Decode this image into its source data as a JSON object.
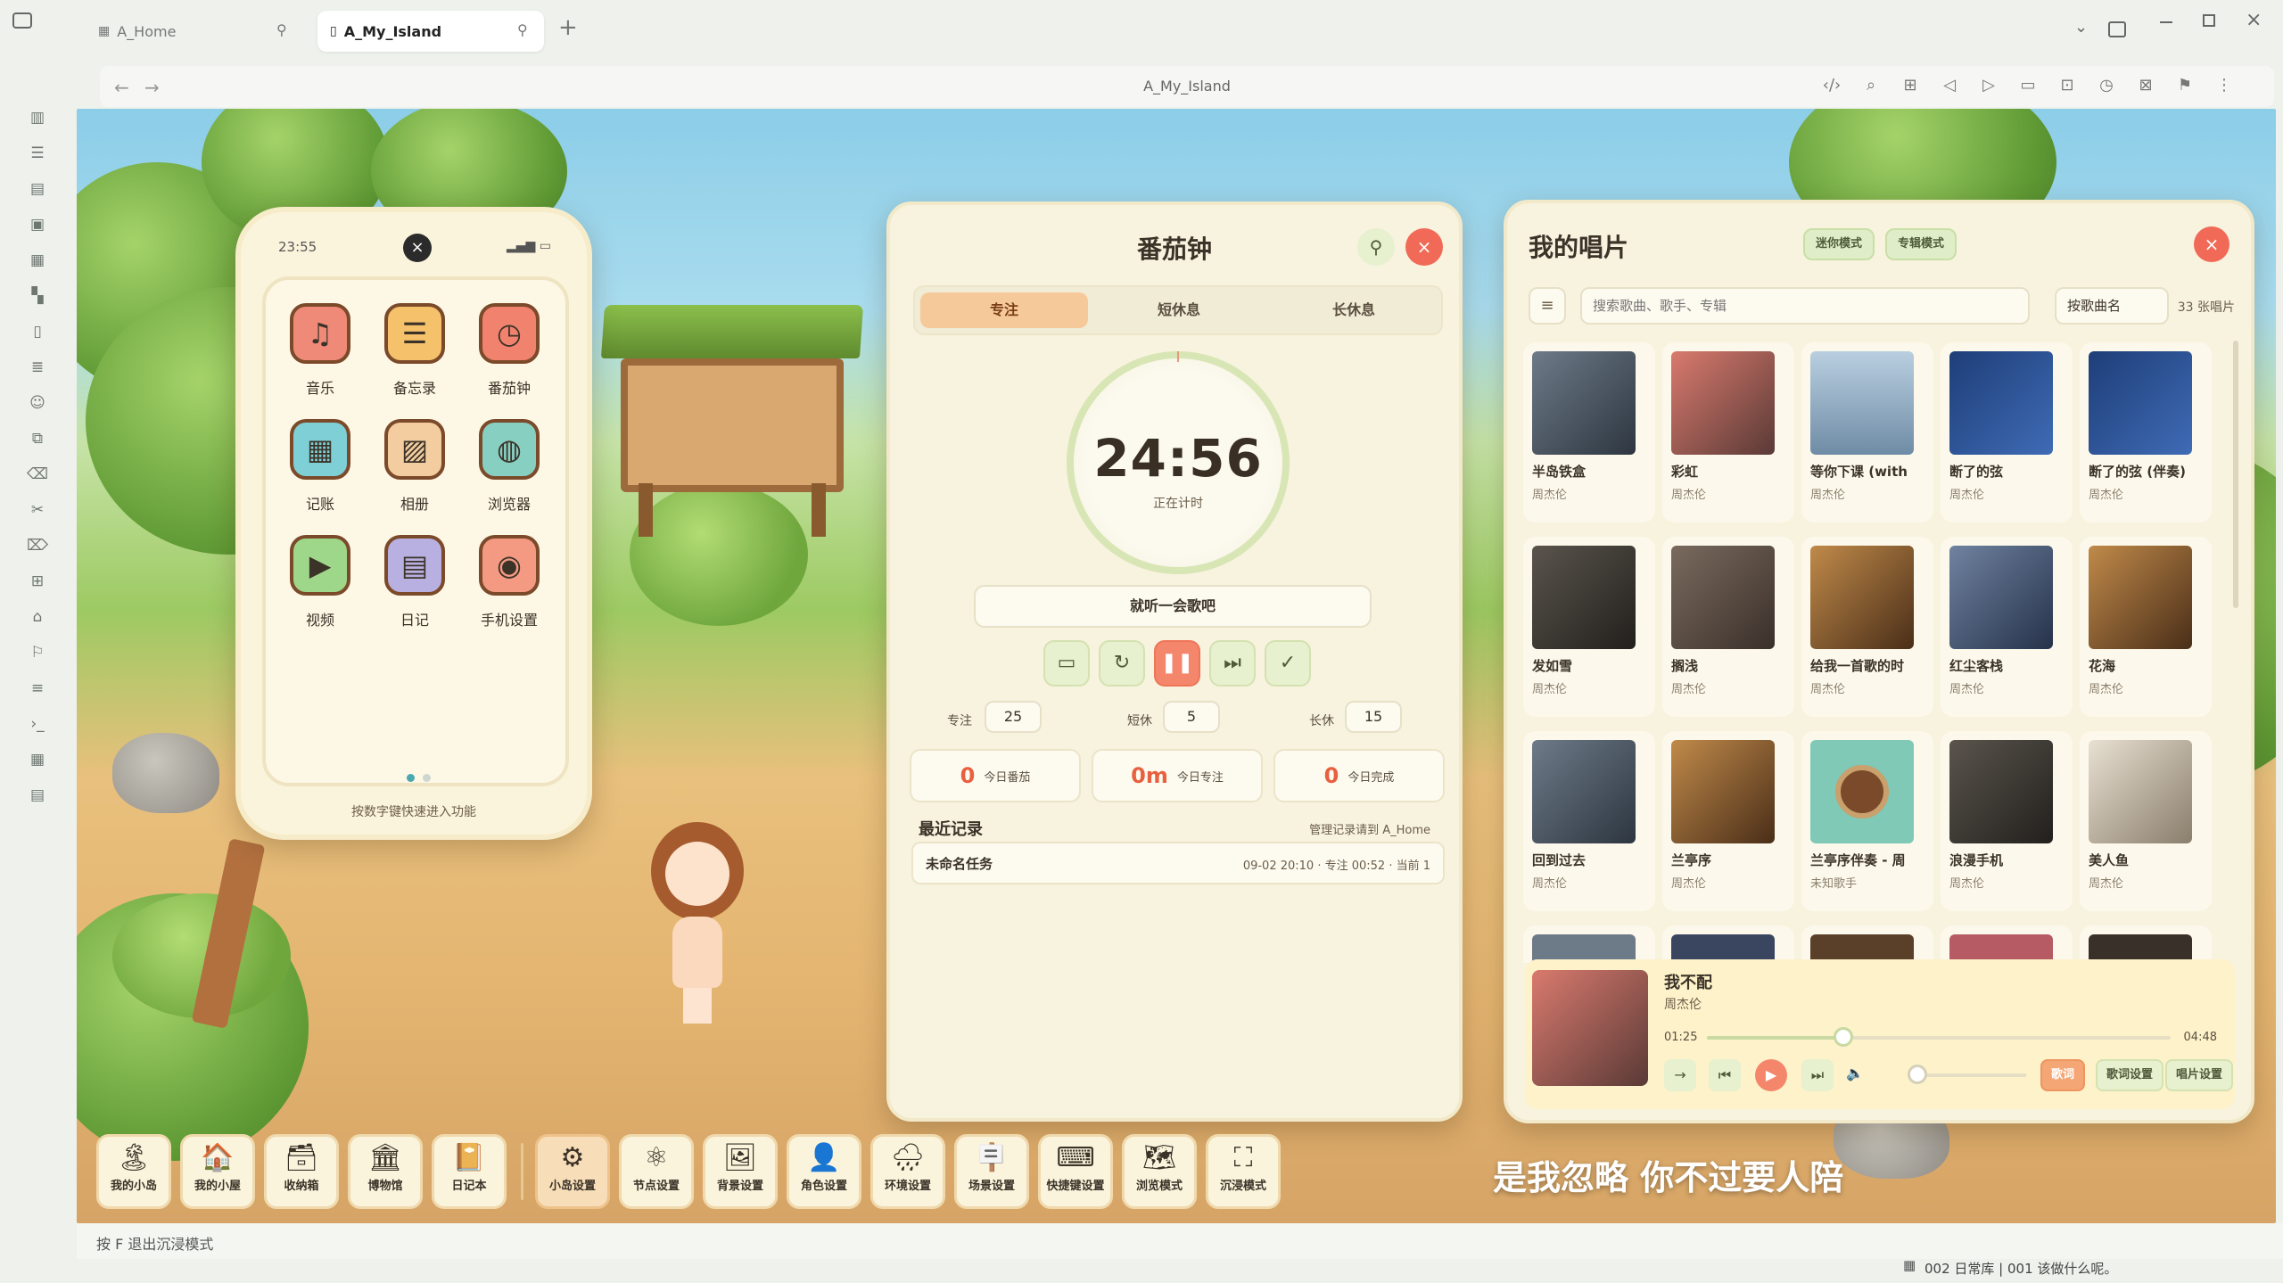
{
  "browser": {
    "tabs": [
      {
        "label": "A_Home",
        "active": false
      },
      {
        "label": "A_My_Island",
        "active": true
      }
    ],
    "new_tab": "+",
    "address": "A_My_Island"
  },
  "phone": {
    "time": "23:55",
    "apps": [
      {
        "label": "音乐",
        "icon": "music-icon",
        "color": "#f08a78"
      },
      {
        "label": "备忘录",
        "icon": "notes-icon",
        "color": "#f5c26b"
      },
      {
        "label": "番茄钟",
        "icon": "tomato-clock-icon",
        "color": "#f0826e"
      },
      {
        "label": "记账",
        "icon": "calculator-icon",
        "color": "#7ed0d6"
      },
      {
        "label": "相册",
        "icon": "photo-icon",
        "color": "#f3cda0"
      },
      {
        "label": "浏览器",
        "icon": "globe-icon",
        "color": "#86cfc1"
      },
      {
        "label": "视频",
        "icon": "video-icon",
        "color": "#9fd78a"
      },
      {
        "label": "日记",
        "icon": "diary-icon",
        "color": "#b9b0e2"
      },
      {
        "label": "手机设置",
        "icon": "phone-settings-icon",
        "color": "#f59a82"
      }
    ],
    "hint": "按数字键快速进入功能"
  },
  "pomodoro": {
    "title": "番茄钟",
    "tabs": [
      "专注",
      "短休息",
      "长休息"
    ],
    "active_tab": 0,
    "timer": "24:56",
    "timer_status": "正在计时",
    "task": "就听一会歌吧",
    "durations": [
      {
        "label": "专注",
        "value": "25"
      },
      {
        "label": "短休",
        "value": "5"
      },
      {
        "label": "长休",
        "value": "15"
      }
    ],
    "stats": [
      {
        "num": "0",
        "label": "今日番茄"
      },
      {
        "num": "0m",
        "label": "今日专注"
      },
      {
        "num": "0",
        "label": "今日完成"
      }
    ],
    "recent_title": "最近记录",
    "recent_manage": "管理记录请到 A_Home",
    "recent": [
      {
        "name": "未命名任务",
        "meta": "09-02 20:10 · 专注 00:52 · 当前 1"
      }
    ]
  },
  "music": {
    "title": "我的唱片",
    "modes": [
      "迷你模式",
      "专辑模式"
    ],
    "search_placeholder": "搜索歌曲、歌手、专辑",
    "sort": "按歌曲名",
    "count": "33 张唱片",
    "songs": [
      {
        "title": "半岛铁盒",
        "artist": "周杰伦",
        "cover": "#5d6a78"
      },
      {
        "title": "彩虹",
        "artist": "周杰伦",
        "cover": "#b65a63"
      },
      {
        "title": "等你下课 (with",
        "artist": "周杰伦",
        "cover": "#7ea3c4"
      },
      {
        "title": "断了的弦",
        "artist": "周杰伦",
        "cover": "#2d4f8a"
      },
      {
        "title": "断了的弦 (伴奏)",
        "artist": "周杰伦",
        "cover": "#2d4f8a"
      },
      {
        "title": "发如雪",
        "artist": "周杰伦",
        "cover": "#3e3a36"
      },
      {
        "title": "搁浅",
        "artist": "周杰伦",
        "cover": "#5d5048"
      },
      {
        "title": "给我一首歌的时",
        "artist": "周杰伦",
        "cover": "#8a5a2f"
      },
      {
        "title": "红尘客栈",
        "artist": "周杰伦",
        "cover": "#4c5e78"
      },
      {
        "title": "花海",
        "artist": "周杰伦",
        "cover": "#8a5a2f"
      },
      {
        "title": "回到过去",
        "artist": "周杰伦",
        "cover": "#5d6a78"
      },
      {
        "title": "兰亭序",
        "artist": "周杰伦",
        "cover": "#8a5a2f"
      },
      {
        "title": "兰亭序伴奏 - 周",
        "artist": "未知歌手",
        "cover": "#7fc9b6"
      },
      {
        "title": "浪漫手机",
        "artist": "周杰伦",
        "cover": "#3e3a36"
      },
      {
        "title": "美人鱼",
        "artist": "周杰伦",
        "cover": "#d8cfc0"
      }
    ],
    "now_playing": {
      "title": "我不配",
      "artist": "周杰伦",
      "current": "01:25",
      "total": "04:48",
      "progress": 0.295,
      "volume": 0.05
    },
    "buttons": [
      "歌词",
      "歌词设置",
      "唱片设置"
    ]
  },
  "lyric": "是我忽略 你不过要人陪",
  "dock": [
    {
      "label": "我的小岛",
      "icon": "🏝"
    },
    {
      "label": "我的小屋",
      "icon": "🏠"
    },
    {
      "label": "收纳箱",
      "icon": "🗃"
    },
    {
      "label": "博物馆",
      "icon": "🏛"
    },
    {
      "label": "日记本",
      "icon": "📔"
    },
    {
      "label": "小岛设置",
      "icon": "⚙"
    },
    {
      "label": "节点设置",
      "icon": "⚛"
    },
    {
      "label": "背景设置",
      "icon": "🖼"
    },
    {
      "label": "角色设置",
      "icon": "👤"
    },
    {
      "label": "环境设置",
      "icon": "🌧"
    },
    {
      "label": "场景设置",
      "icon": "🪧"
    },
    {
      "label": "快捷键设置",
      "icon": "⌨"
    },
    {
      "label": "浏览模式",
      "icon": "🗺"
    },
    {
      "label": "沉浸模式",
      "icon": "⛶"
    }
  ],
  "hint": "按 F 退出沉浸模式",
  "status": "002 日常库 | 001 该做什么呢。"
}
